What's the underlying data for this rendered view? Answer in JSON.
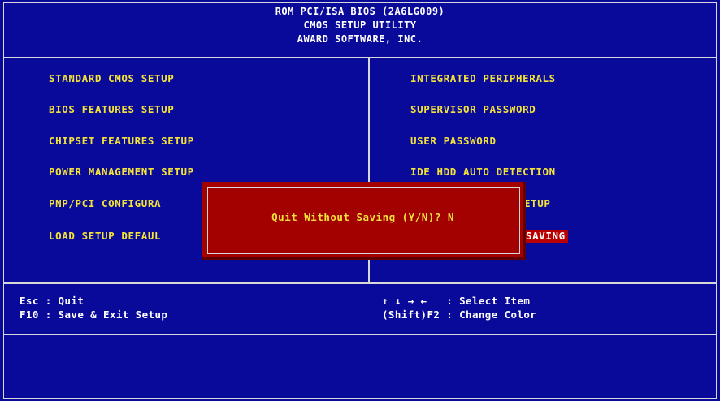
{
  "header": {
    "line1": "ROM PCI/ISA BIOS (2A6LG009)",
    "line2": "CMOS SETUP UTILITY",
    "line3": "AWARD SOFTWARE, INC."
  },
  "menu": {
    "left": [
      "STANDARD CMOS SETUP",
      "BIOS FEATURES SETUP",
      "CHIPSET FEATURES SETUP",
      "POWER MANAGEMENT SETUP",
      "PNP/PCI CONFIGURA",
      "LOAD SETUP DEFAUL"
    ],
    "right": [
      "INTEGRATED PERIPHERALS",
      "SUPERVISOR PASSWORD",
      "USER PASSWORD",
      "IDE HDD AUTO DETECTION",
      "ETUP",
      "SAVING"
    ],
    "selected": "SAVING"
  },
  "help": {
    "esc": "Esc : Quit",
    "f10": "F10 : Save & Exit Setup",
    "arrows": "↑ ↓ → ←   : Select Item",
    "shift_f2": "(Shift)F2 : Change Color"
  },
  "dialog": {
    "prompt": "Quit Without Saving (Y/N)? N"
  },
  "colors": {
    "background": "#0a0a9a",
    "menu_text": "#f2e23a",
    "dialog_bg": "#a30000",
    "highlight_bg": "#b80000"
  }
}
